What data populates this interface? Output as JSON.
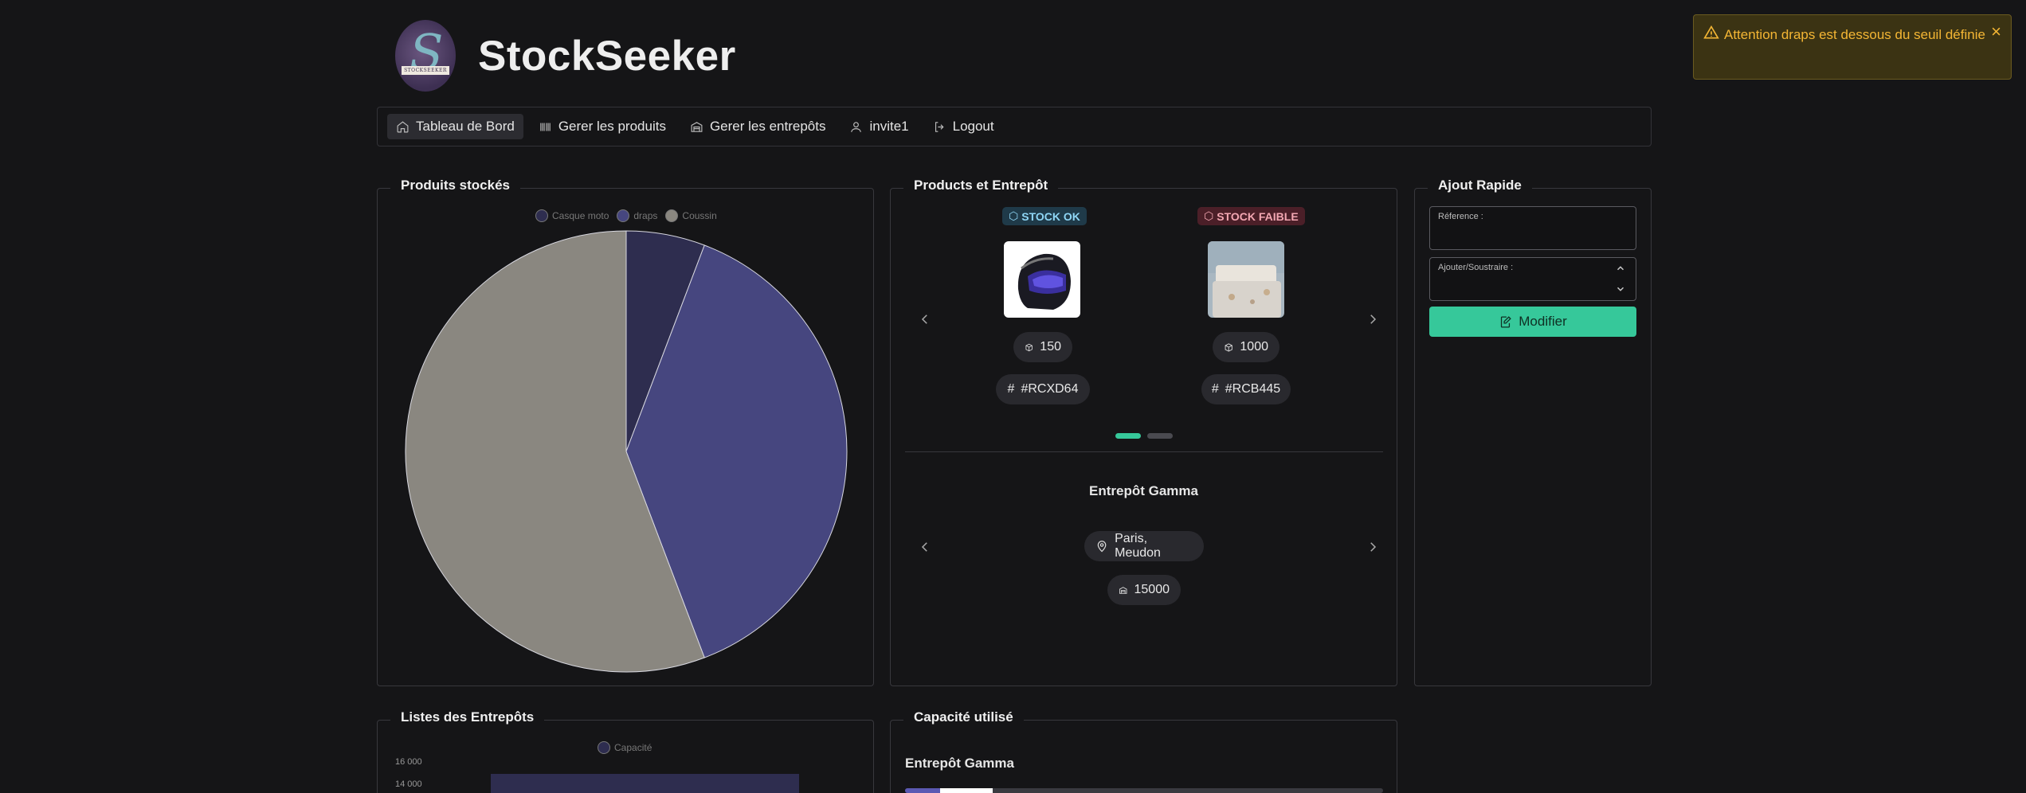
{
  "app": {
    "title": "StockSeeker",
    "logo_text": "STOCKSEEKER"
  },
  "nav": {
    "items": [
      {
        "label": "Tableau de Bord",
        "icon": "home-icon",
        "active": true
      },
      {
        "label": "Gerer les produits",
        "icon": "barcode-icon"
      },
      {
        "label": "Gerer les entrepôts",
        "icon": "warehouse-icon"
      },
      {
        "label": "invite1",
        "icon": "user-icon"
      },
      {
        "label": "Logout",
        "icon": "logout-icon"
      }
    ]
  },
  "stocked": {
    "title": "Produits stockés",
    "legend": [
      {
        "label": "Casque moto",
        "color": "#2e2d4f"
      },
      {
        "label": "draps",
        "color": "#46467f"
      },
      {
        "label": "Coussin",
        "color": "#8a8780"
      }
    ]
  },
  "chart_data": {
    "type": "pie",
    "labels": [
      "Casque moto",
      "draps",
      "Coussin"
    ],
    "values": [
      150,
      1000,
      1450
    ],
    "colors": [
      "#2e2d4f",
      "#46467f",
      "#8a8780"
    ]
  },
  "products": {
    "title": "Products et Entrepôt",
    "items": [
      {
        "badge": "STOCK OK",
        "quantity": "150",
        "reference": "#RCXD64"
      },
      {
        "badge": "STOCK FAIBLE",
        "quantity": "1000",
        "reference": "#RCB445"
      }
    ],
    "warehouse": {
      "name": "Entrepôt Gamma",
      "location": "Paris, Meudon",
      "capacity": "15000"
    }
  },
  "quick_add": {
    "title": "Ajout Rapide",
    "reference_label": "Réference :",
    "adjust_label": "Ajouter/Soustraire :",
    "button_label": "Modifier"
  },
  "warehouses_list": {
    "title": "Listes des Entrepôts",
    "legend_label": "Capacité",
    "ticks": [
      "16 000",
      "14 000"
    ]
  },
  "capacity": {
    "title": "Capacité utilisé",
    "warehouse_name": "Entrepôt Gamma"
  },
  "toast": {
    "message": "Attention draps est dessous du seuil définie"
  }
}
